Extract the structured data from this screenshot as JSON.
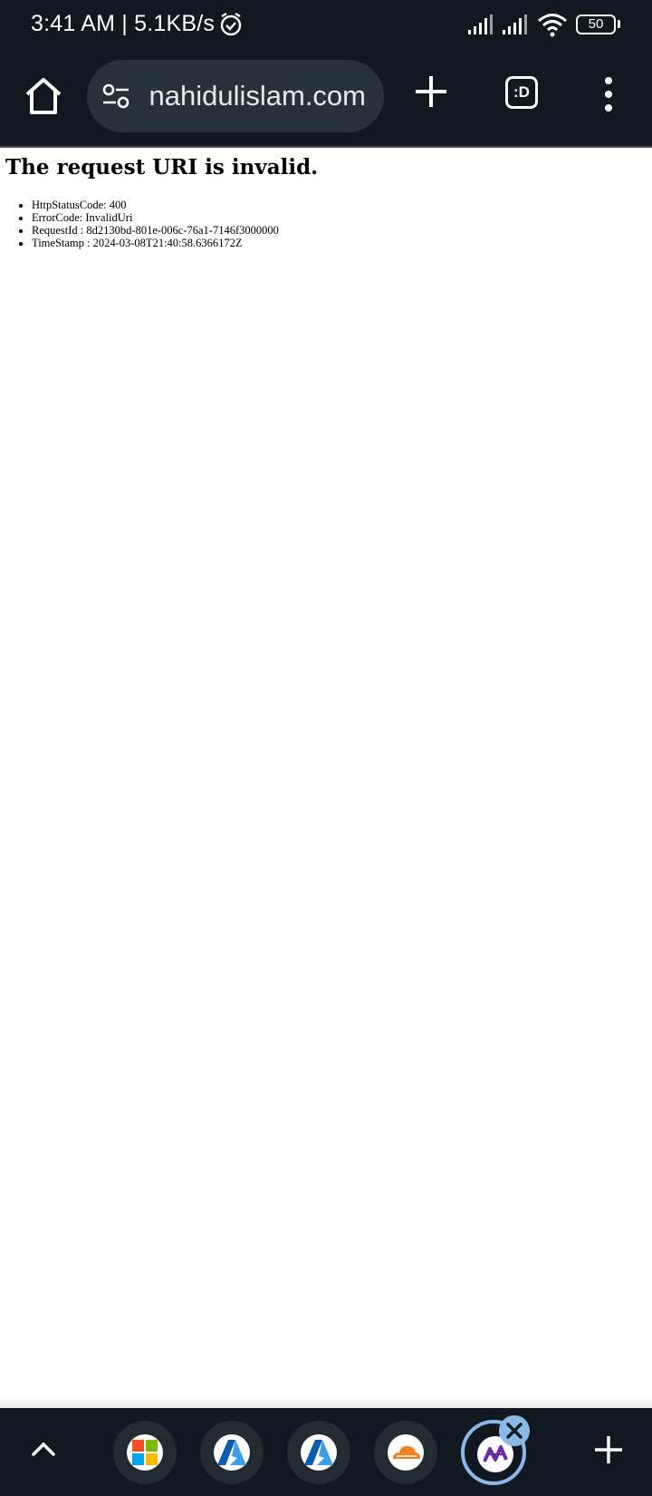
{
  "status_bar": {
    "time_and_speed": "3:41 AM | 5.1KB/s",
    "battery_level": "50"
  },
  "toolbar": {
    "url": "nahidulislam.com",
    "tab_count_label": ":D"
  },
  "page": {
    "title": "The request URI is invalid.",
    "details": [
      "HttpStatusCode: 400",
      "ErrorCode: InvalidUri",
      "RequestId : 8d2130bd-801e-006c-76a1-7146f3000000",
      "TimeStamp : 2024-03-08T21:40:58.6366172Z"
    ]
  },
  "bottom_bar": {
    "tab_group": [
      {
        "icon": "microsoft-icon"
      },
      {
        "icon": "azure-icon"
      },
      {
        "icon": "azure-icon"
      },
      {
        "icon": "cloudflare-icon"
      },
      {
        "icon": "site-logo-icon",
        "active": true
      }
    ]
  },
  "colors": {
    "chrome_background": "#121820",
    "omnibox_background": "#28313a",
    "active_tab_ring": "#8ab8e8"
  }
}
